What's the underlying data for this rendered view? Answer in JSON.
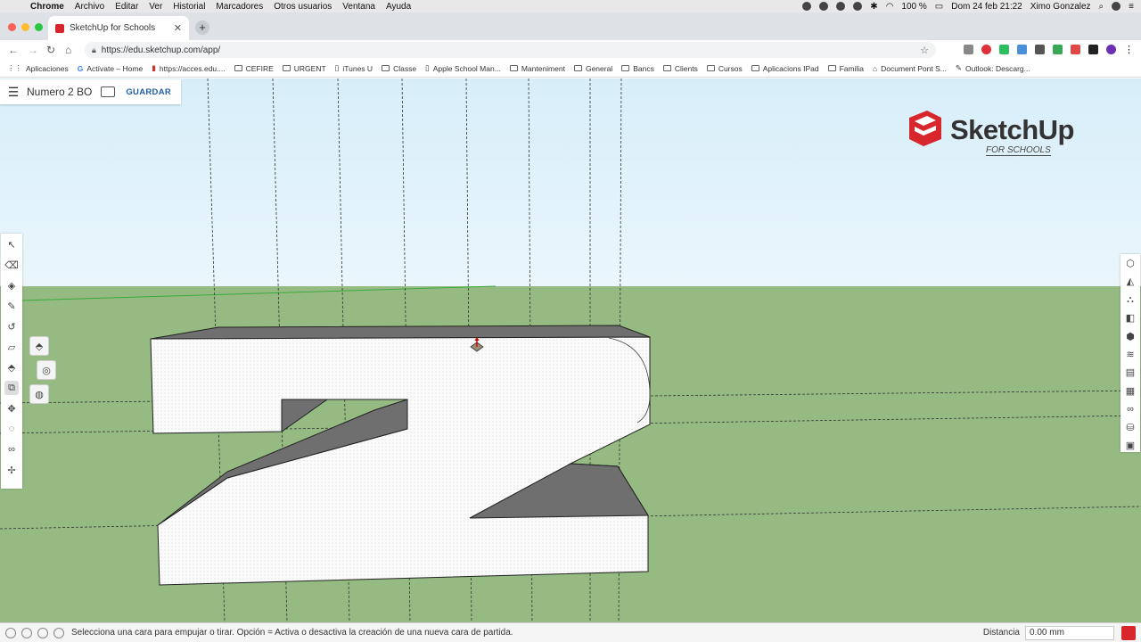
{
  "menubar": {
    "app": "Chrome",
    "items": [
      "Archivo",
      "Editar",
      "Ver",
      "Historial",
      "Marcadores",
      "Otros usuarios",
      "Ventana",
      "Ayuda"
    ],
    "battery": "100 %",
    "datetime": "Dom 24 feb  21:22",
    "user": "Ximo Gonzalez"
  },
  "browser": {
    "tab_title": "SketchUp for Schools",
    "url": "https://edu.sketchup.com/app/",
    "bookmarks": [
      "Aplicaciones",
      "Actívate – Home",
      "https://acces.edu....",
      "CEFIRE",
      "URGENT",
      "iTunes U",
      "Classe",
      "Apple School Man...",
      "Manteniment",
      "General",
      "Bancs",
      "Clients",
      "Cursos",
      "Aplicacions IPad",
      "Familia",
      "Document Pont S...",
      "Outlook: Descarg..."
    ]
  },
  "app": {
    "file_name": "Numero 2 BO",
    "save_label": "GUARDAR",
    "logo_word": "SketchUp",
    "logo_sub": "FOR SCHOOLS",
    "active_tool": "push-pull",
    "colors": {
      "sky": "#d7eef9",
      "ground": "#95bb82",
      "brand": "#d7262c",
      "save": "#1e5ea8"
    }
  },
  "status": {
    "message": "Selecciona una cara para empujar o tirar. Opción = Activa o desactiva la creación de una nueva cara de partida.",
    "distance_label": "Distancia",
    "distance_value": "0.00 mm"
  }
}
